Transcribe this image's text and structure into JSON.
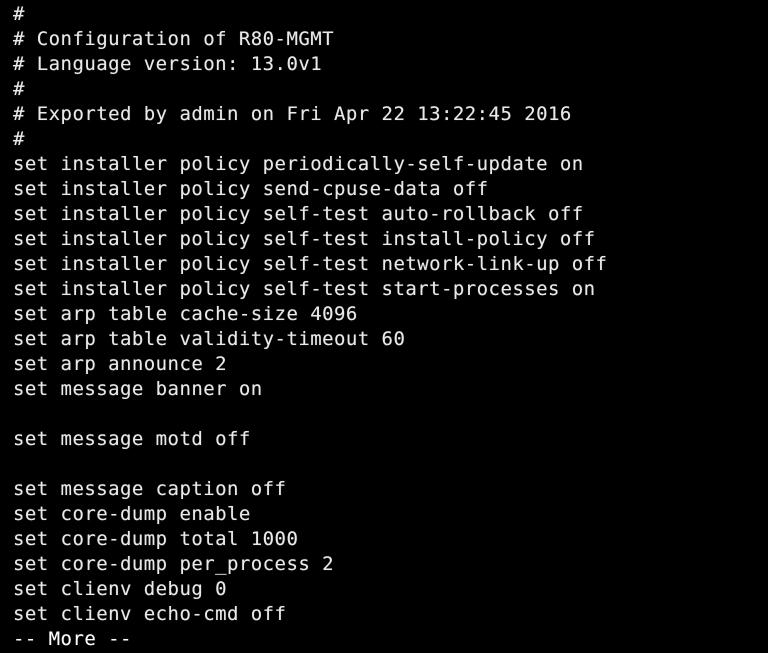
{
  "terminal": {
    "screen_name": "gaia-clish-terminal",
    "background_color": "#000000",
    "foreground_color": "#e9e9e9",
    "columns": 57,
    "rows": 26,
    "pager_prompt": "-- More --",
    "header": {
      "config_title": "# Configuration of R80-MGMT",
      "language_version": "# Language version: 13.0v1",
      "exported_by": "# Exported by admin on Fri Apr 22 13:22:45 2016",
      "hostname": "R80-MGMT",
      "version": "13.0v1",
      "user": "admin",
      "timestamp": "Fri Apr 22 13:22:45 2016"
    },
    "lines": [
      "#",
      "# Configuration of R80-MGMT",
      "# Language version: 13.0v1",
      "#",
      "# Exported by admin on Fri Apr 22 13:22:45 2016",
      "#",
      "set installer policy periodically-self-update on",
      "set installer policy send-cpuse-data off",
      "set installer policy self-test auto-rollback off",
      "set installer policy self-test install-policy off",
      "set installer policy self-test network-link-up off",
      "set installer policy self-test start-processes on",
      "set arp table cache-size 4096",
      "set arp table validity-timeout 60",
      "set arp announce 2",
      "set message banner on",
      "",
      "set message motd off",
      "",
      "set message caption off",
      "set core-dump enable",
      "set core-dump total 1000",
      "set core-dump per_process 2",
      "set clienv debug 0",
      "set clienv echo-cmd off",
      "-- More --"
    ]
  }
}
